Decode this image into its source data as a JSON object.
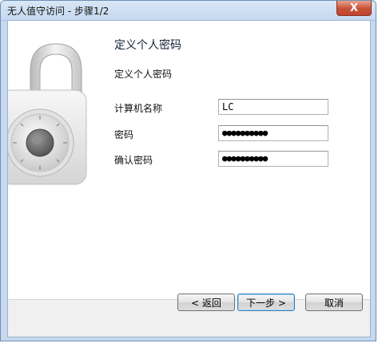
{
  "window": {
    "title": "无人值守访问 - 步骤1/2",
    "close_glyph": "X"
  },
  "page": {
    "heading": "定义个人密码",
    "subheading": "定义个人密码"
  },
  "form": {
    "computer_name_label": "计算机名称",
    "computer_name_value": "LC",
    "password_label": "密码",
    "password_mask": "●●●●●●●●●●",
    "confirm_label": "确认密码",
    "confirm_mask": "●●●●●●●●●●"
  },
  "buttons": {
    "back": "< 返回",
    "next": "下一步 >",
    "cancel": "取消"
  },
  "icons": {
    "lock": "padlock-icon"
  }
}
